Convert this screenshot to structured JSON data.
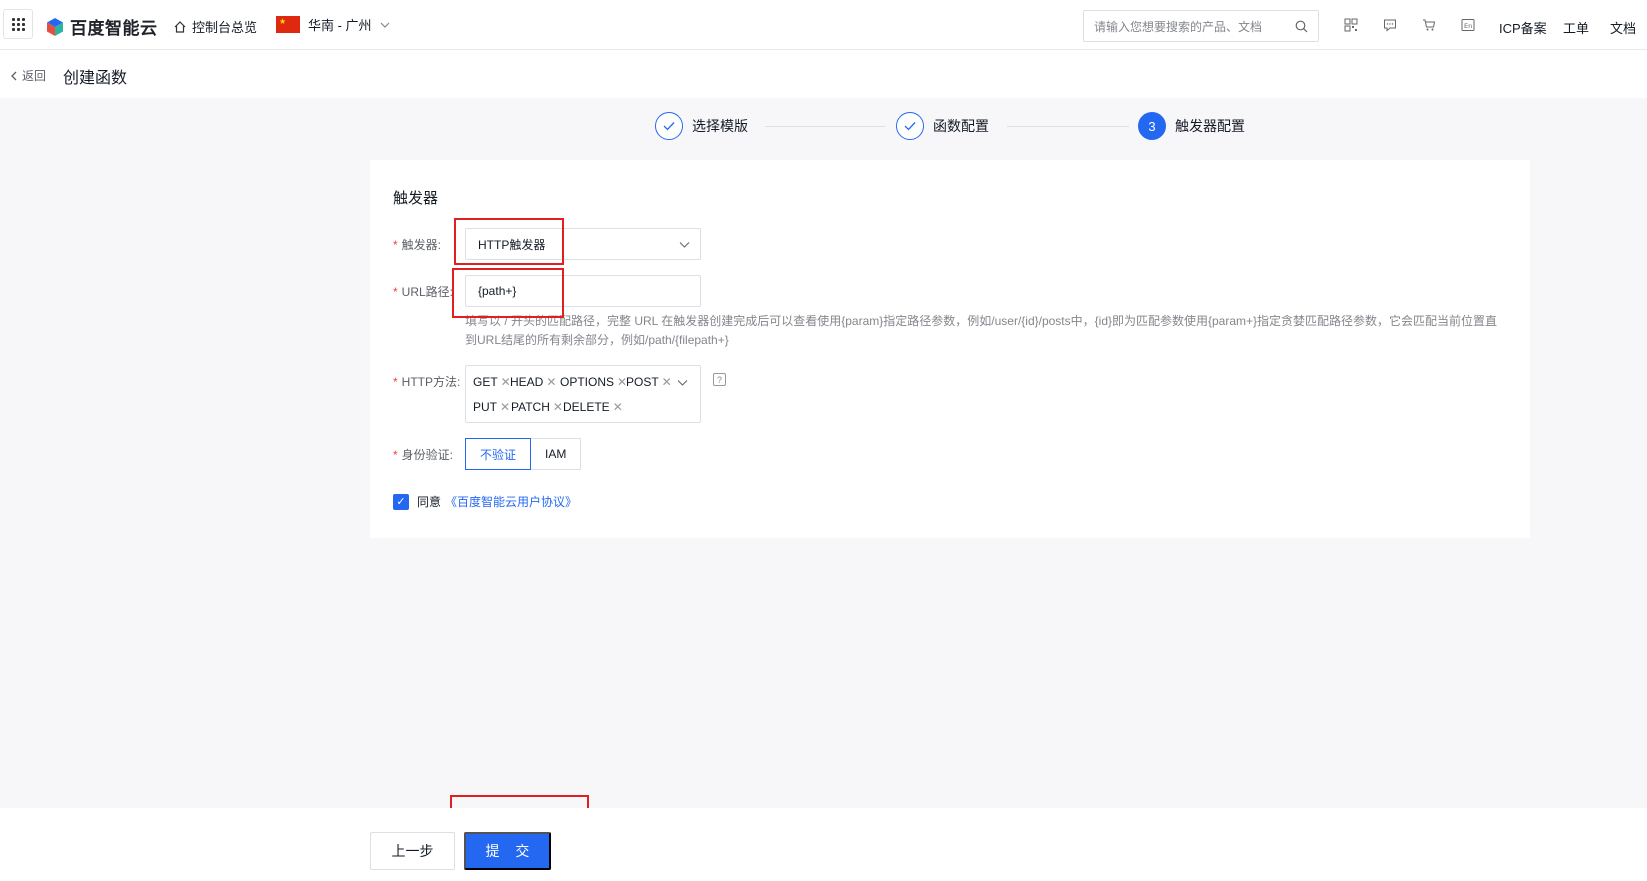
{
  "topbar": {
    "brand": "百度智能云",
    "overview": "控制台总览",
    "region": "华南 - 广州",
    "search_placeholder": "请输入您想要搜索的产品、文档",
    "links": [
      "ICP备案",
      "工单",
      "文档"
    ]
  },
  "header": {
    "back": "返回",
    "title": "创建函数"
  },
  "steps": [
    {
      "label": "选择模版",
      "status": "done"
    },
    {
      "label": "函数配置",
      "status": "done"
    },
    {
      "label": "触发器配置",
      "status": "active",
      "number": "3"
    }
  ],
  "form": {
    "section_title": "触发器",
    "trigger_label": "触发器:",
    "trigger_value": "HTTP触发器",
    "url_label": "URL路径:",
    "url_value": "{path+}",
    "url_hint": "填写以 / 开头的匹配路径，完整 URL 在触发器创建完成后可以查看使用{param}指定路径参数，例如/user/{id}/posts中，{id}即为匹配参数使用{param+}指定贪婪匹配路径参数，它会匹配当前位置直到URL结尾的所有剩余部分，例如/path/{filepath+}",
    "method_label": "HTTP方法:",
    "methods": [
      "GET",
      "HEAD",
      "OPTIONS",
      "POST",
      "PUT",
      "PATCH",
      "DELETE"
    ],
    "auth_label": "身份验证:",
    "auth_options": [
      "不验证",
      "IAM"
    ],
    "auth_selected": "不验证",
    "agree_text": "同意",
    "agree_link": "《百度智能云用户协议》"
  },
  "footer": {
    "prev": "上一步",
    "submit": "提 交"
  },
  "colors": {
    "accent": "#2468f2",
    "annotation": "#e02020"
  }
}
